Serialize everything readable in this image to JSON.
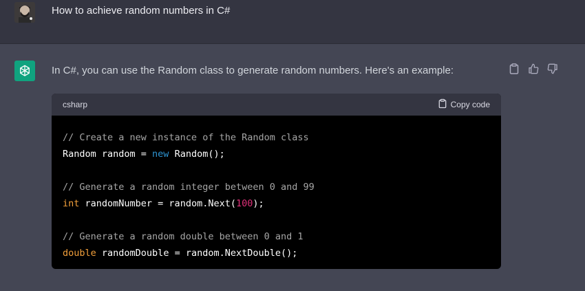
{
  "user_message": {
    "text": "How to achieve random numbers in C#"
  },
  "assistant_message": {
    "text": "In C#, you can use the Random class to generate random numbers. Here's an example:",
    "actions": {
      "copy_icon": "clipboard-icon",
      "like_icon": "thumbs-up-icon",
      "dislike_icon": "thumbs-down-icon"
    }
  },
  "code_block": {
    "language": "csharp",
    "copy_label": "Copy code",
    "lines": {
      "l1": {
        "comment": "// Create a new instance of the Random class"
      },
      "l2": {
        "a": "Random random = ",
        "kw": "new",
        "b": " Random();"
      },
      "l4": {
        "comment": "// Generate a random integer between 0 and 99"
      },
      "l5": {
        "kw": "int",
        "a": " randomNumber = random.Next(",
        "num": "100",
        "b": ");"
      },
      "l7": {
        "comment": "// Generate a random double between 0 and 1"
      },
      "l8": {
        "kw": "double",
        "a": " randomDouble = random.NextDouble();"
      }
    }
  },
  "colors": {
    "user_bg": "#343541",
    "assistant_bg": "#444654",
    "brand_green": "#10a37f",
    "code_keyword_blue": "#2e95d3",
    "code_keyword_orange": "#f3a03b",
    "code_number": "#df3079"
  }
}
